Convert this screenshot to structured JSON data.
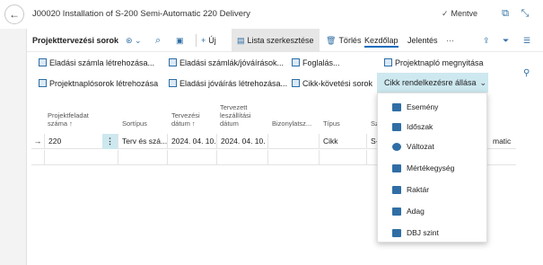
{
  "window": {
    "title": "J00020 Installation of S-200 Semi-Automatic 220 Delivery",
    "saved_label": "Mentve"
  },
  "actionbar": {
    "section_title": "Projekttervezési sorok",
    "new_label": "Új",
    "edit_list_label": "Lista szerkesztése",
    "delete_label": "Törlés",
    "home_label": "Kezdőlap",
    "reports_label": "Jelentés",
    "more_label": "···"
  },
  "promoted": {
    "create_sales_invoice": "Eladási számla létrehozása...",
    "sales_invoices_credit": "Eladási számlák/jóváírások...",
    "reserve": "Foglalás...",
    "open_project_journal": "Projektnapló megnyitása",
    "create_journal_lines": "Projektnaplósorok létrehozása",
    "create_sales_credit": "Eladási jóváírás létrehozása...",
    "item_tracking_lines": "Cikk-követési sorok",
    "item_availability_by": "Cikk rendelkezésre állása"
  },
  "grid": {
    "headers": {
      "task_no_1": "Projektfeladat",
      "task_no_2": "száma ↑",
      "line_type": "Sortípus",
      "planning_date_1": "Tervezési",
      "planning_date_2": "dátum ↑",
      "planned_delivery_1": "Tervezett",
      "planned_delivery_2": "leszállítási",
      "planned_delivery_3": "dátum",
      "document_no": "Bizonylatsz...",
      "type": "Típus",
      "no": "Szám"
    },
    "rows": [
      {
        "task_no": "220",
        "line_type": "Terv és szá...",
        "planning_date": "2024. 04. 10.",
        "planned_delivery": "2024. 04. 10.",
        "document_no": "",
        "type": "Cikk",
        "no": "S-210",
        "desc_tail": "matic"
      }
    ]
  },
  "menu": {
    "items": [
      "Esemény",
      "Időszak",
      "Változat",
      "Mértékegység",
      "Raktár",
      "Adag",
      "DBJ szint"
    ]
  }
}
